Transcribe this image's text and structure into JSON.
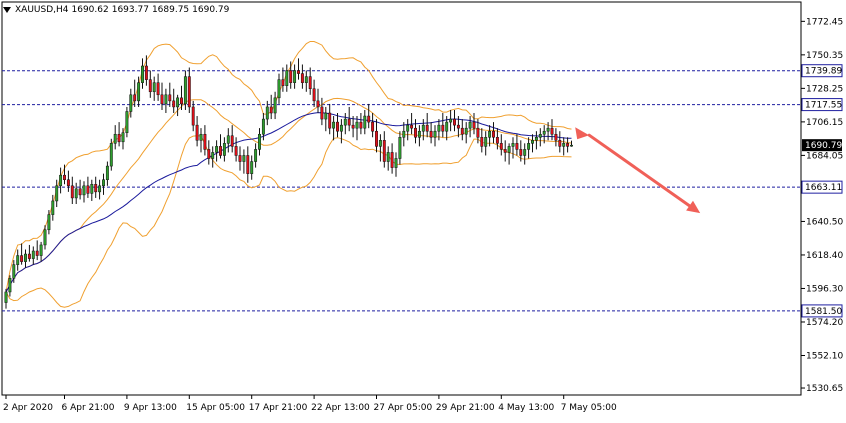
{
  "header": {
    "symbol": "XAUUSD,H4",
    "open": "1690.62",
    "high": "1693.77",
    "low": "1689.75",
    "close": "1690.79"
  },
  "colors": {
    "bull": "#2e9e2e",
    "bear": "#e0101a",
    "bollinger": "#f0a030",
    "moving_average": "#1a1a9c",
    "level_line": "#1f1fa0",
    "arrow": "#f06058",
    "grid_bg": "#ffffff"
  },
  "chart_data": {
    "type": "candlestick",
    "price_axis": {
      "ylim": [
        1526.05,
        1785.2
      ],
      "ticks": [
        1772.45,
        1750.35,
        1728.25,
        1706.15,
        1684.05,
        1662.0,
        1640.5,
        1618.4,
        1596.3,
        1574.2,
        1552.1,
        1530.65
      ],
      "tick_labels": [
        "1772.45",
        "1750.35",
        "1728.25",
        "1706.15",
        "1684.05",
        "",
        "1640.50",
        "1618.40",
        "1596.30",
        "1574.20",
        "1552.10",
        "1530.65"
      ]
    },
    "time_axis": {
      "labels": [
        "2 Apr 2020",
        "6 Apr 21:00",
        "9 Apr 13:00",
        "15 Apr 05:00",
        "17 Apr 21:00",
        "22 Apr 13:00",
        "27 Apr 05:00",
        "29 Apr 21:00",
        "4 May 13:00",
        "7 May 05:00"
      ],
      "label_bar_index": [
        0,
        15,
        31,
        47,
        63,
        79,
        95,
        111,
        127,
        143
      ]
    },
    "levels": [
      {
        "value": 1739.89,
        "label": "1739.89"
      },
      {
        "value": 1717.55,
        "label": "1717.55"
      },
      {
        "value": 1663.11,
        "label": "1663.11"
      },
      {
        "value": 1581.5,
        "label": "1581.50"
      }
    ],
    "current_price": {
      "value": 1690.79,
      "label": "1690.79"
    },
    "candles": [
      [
        1587,
        1596,
        1583,
        1594
      ],
      [
        1594,
        1605,
        1591,
        1603
      ],
      [
        1603,
        1615,
        1600,
        1612
      ],
      [
        1612,
        1622,
        1608,
        1618
      ],
      [
        1618,
        1626,
        1612,
        1614
      ],
      [
        1614,
        1622,
        1610,
        1619
      ],
      [
        1619,
        1625,
        1614,
        1616
      ],
      [
        1616,
        1624,
        1612,
        1621
      ],
      [
        1621,
        1628,
        1615,
        1618
      ],
      [
        1618,
        1627,
        1614,
        1625
      ],
      [
        1625,
        1638,
        1622,
        1635
      ],
      [
        1635,
        1648,
        1632,
        1645
      ],
      [
        1645,
        1658,
        1641,
        1654
      ],
      [
        1654,
        1668,
        1650,
        1664
      ],
      [
        1664,
        1676,
        1659,
        1671
      ],
      [
        1671,
        1678,
        1665,
        1668
      ],
      [
        1668,
        1674,
        1660,
        1664
      ],
      [
        1664,
        1670,
        1652,
        1656
      ],
      [
        1656,
        1666,
        1652,
        1662
      ],
      [
        1662,
        1668,
        1655,
        1658
      ],
      [
        1658,
        1667,
        1653,
        1664
      ],
      [
        1664,
        1670,
        1656,
        1659
      ],
      [
        1659,
        1668,
        1654,
        1665
      ],
      [
        1665,
        1670,
        1656,
        1660
      ],
      [
        1660,
        1668,
        1655,
        1664
      ],
      [
        1664,
        1672,
        1658,
        1668
      ],
      [
        1668,
        1680,
        1664,
        1677
      ],
      [
        1677,
        1695,
        1674,
        1692
      ],
      [
        1692,
        1704,
        1688,
        1698
      ],
      [
        1698,
        1706,
        1690,
        1693
      ],
      [
        1693,
        1702,
        1688,
        1699
      ],
      [
        1699,
        1716,
        1696,
        1713
      ],
      [
        1713,
        1728,
        1709,
        1724
      ],
      [
        1724,
        1734,
        1716,
        1720
      ],
      [
        1720,
        1736,
        1716,
        1732
      ],
      [
        1732,
        1748,
        1728,
        1743
      ],
      [
        1743,
        1750,
        1730,
        1734
      ],
      [
        1734,
        1740,
        1722,
        1726
      ],
      [
        1726,
        1736,
        1720,
        1732
      ],
      [
        1732,
        1738,
        1720,
        1724
      ],
      [
        1724,
        1732,
        1714,
        1718
      ],
      [
        1718,
        1728,
        1712,
        1724
      ],
      [
        1724,
        1732,
        1716,
        1720
      ],
      [
        1720,
        1728,
        1712,
        1716
      ],
      [
        1716,
        1724,
        1710,
        1722
      ],
      [
        1722,
        1730,
        1714,
        1718
      ],
      [
        1718,
        1740,
        1714,
        1736
      ],
      [
        1736,
        1742,
        1712,
        1716
      ],
      [
        1716,
        1720,
        1700,
        1704
      ],
      [
        1704,
        1710,
        1690,
        1694
      ],
      [
        1694,
        1702,
        1686,
        1698
      ],
      [
        1698,
        1704,
        1684,
        1688
      ],
      [
        1688,
        1694,
        1678,
        1682
      ],
      [
        1682,
        1690,
        1676,
        1686
      ],
      [
        1686,
        1694,
        1680,
        1690
      ],
      [
        1690,
        1698,
        1682,
        1684
      ],
      [
        1684,
        1696,
        1680,
        1692
      ],
      [
        1692,
        1702,
        1686,
        1697
      ],
      [
        1697,
        1704,
        1686,
        1690
      ],
      [
        1690,
        1696,
        1680,
        1684
      ],
      [
        1684,
        1690,
        1674,
        1680
      ],
      [
        1680,
        1688,
        1672,
        1684
      ],
      [
        1684,
        1690,
        1666,
        1672
      ],
      [
        1672,
        1684,
        1668,
        1680
      ],
      [
        1680,
        1692,
        1676,
        1688
      ],
      [
        1688,
        1702,
        1684,
        1698
      ],
      [
        1698,
        1712,
        1694,
        1708
      ],
      [
        1708,
        1720,
        1704,
        1716
      ],
      [
        1716,
        1724,
        1708,
        1712
      ],
      [
        1712,
        1726,
        1708,
        1722
      ],
      [
        1722,
        1738,
        1718,
        1734
      ],
      [
        1734,
        1742,
        1726,
        1730
      ],
      [
        1730,
        1744,
        1726,
        1740
      ],
      [
        1740,
        1746,
        1728,
        1732
      ],
      [
        1732,
        1744,
        1728,
        1740
      ],
      [
        1740,
        1748,
        1734,
        1738
      ],
      [
        1738,
        1744,
        1728,
        1732
      ],
      [
        1732,
        1740,
        1726,
        1736
      ],
      [
        1736,
        1742,
        1724,
        1728
      ],
      [
        1728,
        1734,
        1716,
        1720
      ],
      [
        1720,
        1728,
        1712,
        1716
      ],
      [
        1716,
        1722,
        1704,
        1708
      ],
      [
        1708,
        1716,
        1700,
        1712
      ],
      [
        1712,
        1718,
        1698,
        1702
      ],
      [
        1702,
        1710,
        1694,
        1706
      ],
      [
        1706,
        1712,
        1696,
        1700
      ],
      [
        1700,
        1708,
        1692,
        1704
      ],
      [
        1704,
        1712,
        1698,
        1708
      ],
      [
        1708,
        1716,
        1700,
        1704
      ],
      [
        1704,
        1710,
        1696,
        1702
      ],
      [
        1702,
        1710,
        1694,
        1706
      ],
      [
        1706,
        1712,
        1698,
        1702
      ],
      [
        1702,
        1714,
        1698,
        1710
      ],
      [
        1710,
        1718,
        1702,
        1706
      ],
      [
        1706,
        1712,
        1696,
        1700
      ],
      [
        1700,
        1708,
        1686,
        1690
      ],
      [
        1690,
        1698,
        1680,
        1694
      ],
      [
        1694,
        1700,
        1676,
        1680
      ],
      [
        1680,
        1690,
        1674,
        1686
      ],
      [
        1686,
        1692,
        1672,
        1676
      ],
      [
        1676,
        1686,
        1670,
        1682
      ],
      [
        1682,
        1700,
        1678,
        1696
      ],
      [
        1696,
        1706,
        1690,
        1700
      ],
      [
        1700,
        1708,
        1694,
        1704
      ],
      [
        1704,
        1712,
        1698,
        1702
      ],
      [
        1702,
        1708,
        1692,
        1696
      ],
      [
        1696,
        1704,
        1690,
        1700
      ],
      [
        1700,
        1708,
        1694,
        1704
      ],
      [
        1704,
        1712,
        1696,
        1700
      ],
      [
        1700,
        1706,
        1692,
        1696
      ],
      [
        1696,
        1704,
        1690,
        1700
      ],
      [
        1700,
        1708,
        1694,
        1704
      ],
      [
        1704,
        1712,
        1696,
        1700
      ],
      [
        1700,
        1710,
        1694,
        1706
      ],
      [
        1706,
        1714,
        1700,
        1708
      ],
      [
        1708,
        1714,
        1700,
        1704
      ],
      [
        1704,
        1710,
        1696,
        1702
      ],
      [
        1702,
        1708,
        1694,
        1698
      ],
      [
        1698,
        1706,
        1692,
        1702
      ],
      [
        1702,
        1710,
        1696,
        1706
      ],
      [
        1706,
        1712,
        1698,
        1702
      ],
      [
        1702,
        1708,
        1692,
        1696
      ],
      [
        1696,
        1702,
        1686,
        1690
      ],
      [
        1690,
        1700,
        1684,
        1696
      ],
      [
        1696,
        1704,
        1690,
        1700
      ],
      [
        1700,
        1706,
        1692,
        1696
      ],
      [
        1696,
        1702,
        1688,
        1692
      ],
      [
        1692,
        1698,
        1684,
        1688
      ],
      [
        1688,
        1694,
        1680,
        1686
      ],
      [
        1686,
        1692,
        1678,
        1690
      ],
      [
        1690,
        1696,
        1682,
        1692
      ],
      [
        1692,
        1698,
        1684,
        1688
      ],
      [
        1688,
        1694,
        1680,
        1684
      ],
      [
        1684,
        1692,
        1678,
        1688
      ],
      [
        1688,
        1696,
        1682,
        1692
      ],
      [
        1692,
        1698,
        1686,
        1694
      ],
      [
        1694,
        1700,
        1688,
        1696
      ],
      [
        1696,
        1702,
        1690,
        1698
      ],
      [
        1698,
        1704,
        1692,
        1700
      ],
      [
        1700,
        1706,
        1694,
        1702
      ],
      [
        1702,
        1708,
        1694,
        1698
      ],
      [
        1698,
        1702,
        1690,
        1694
      ],
      [
        1694,
        1700,
        1686,
        1690
      ],
      [
        1690,
        1696,
        1684,
        1692
      ],
      [
        1692,
        1696,
        1686,
        1690
      ],
      [
        1690.62,
        1693.77,
        1689.75,
        1690.79
      ]
    ],
    "indicators": [
      {
        "kind": "bollinger_bands",
        "period": 20,
        "deviation": 2
      },
      {
        "kind": "moving_average",
        "period": 50
      }
    ],
    "forecast_arrow": {
      "from_bar": 148,
      "from_price": 1700,
      "to_bar": 178,
      "to_price": 1646
    }
  }
}
